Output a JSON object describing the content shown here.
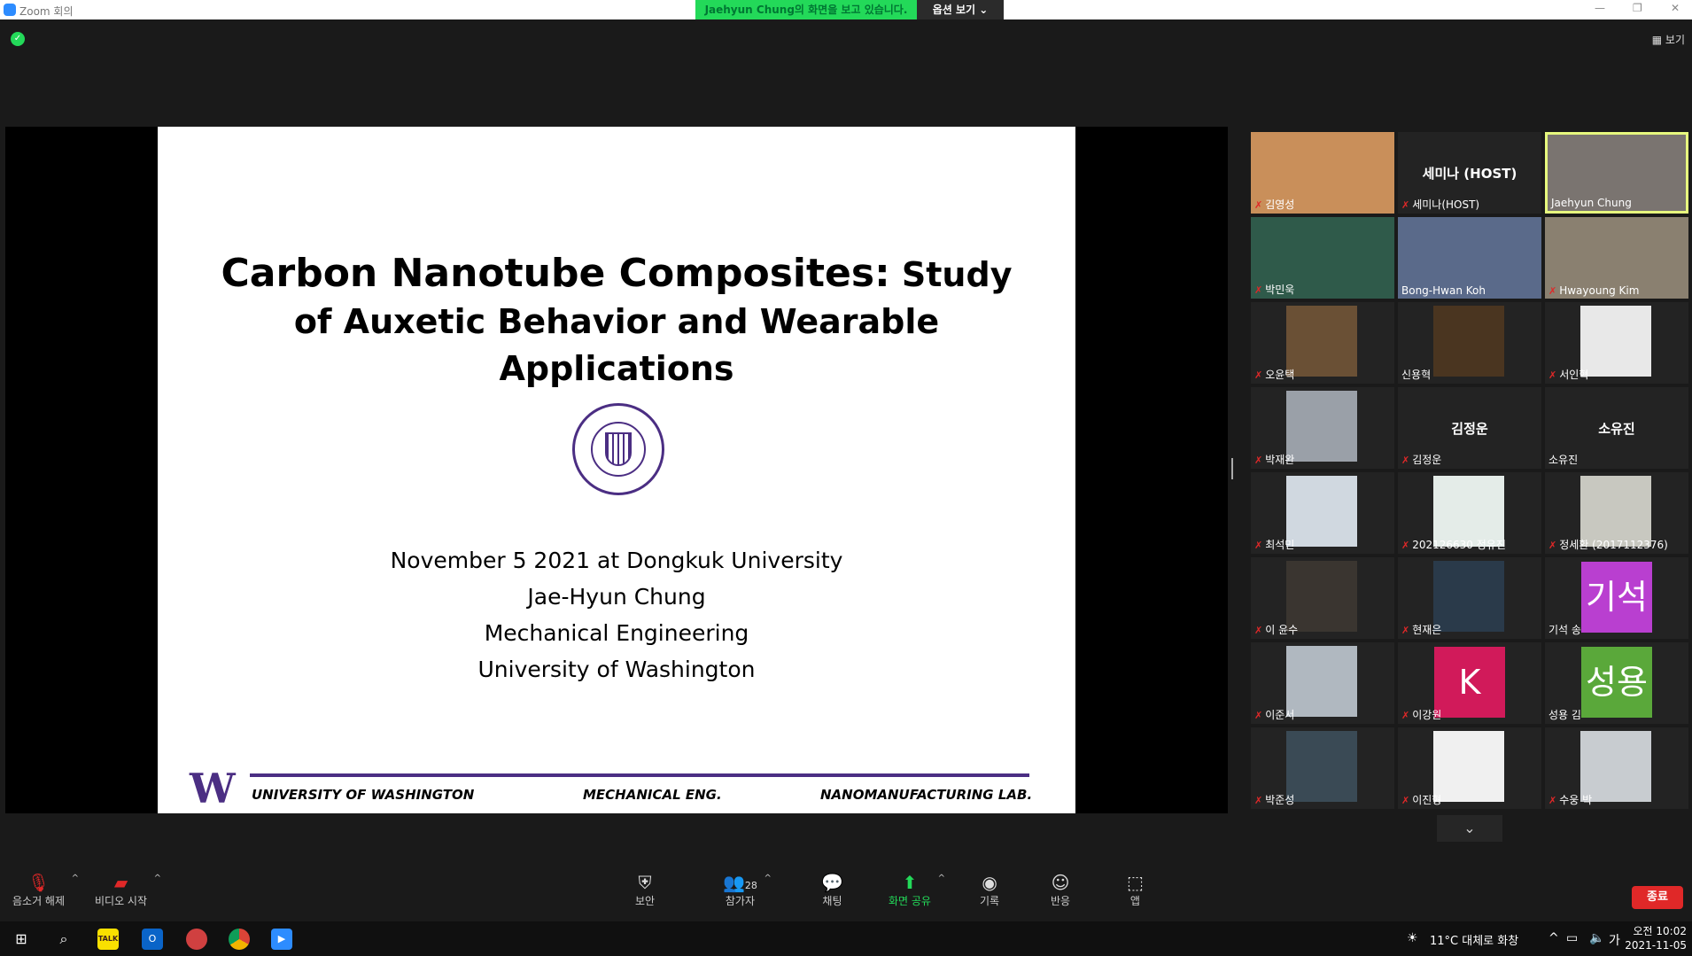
{
  "window": {
    "title": "Zoom 회의",
    "viewing_banner": "Jaehyun Chung의 화면을 보고 있습니다.",
    "view_options": "옵션 보기 ⌄",
    "view_button": "보기"
  },
  "slide": {
    "title_line1a": "Carbon Nanotube Composites:",
    "title_line1b": " Study",
    "title_line2": "of Auxetic Behavior and Wearable",
    "title_line3": "Applications",
    "line1": "November 5 2021 at Dongkuk University",
    "line2": "Jae-Hyun Chung",
    "line3": "Mechanical Engineering",
    "line4": "University of Washington",
    "footer_left": "UNIVERSITY OF WASHINGTON",
    "footer_mid": "MECHANICAL ENG.",
    "footer_right": "NANOMANUFACTURING LAB.",
    "logo_letter": "W"
  },
  "participants": [
    {
      "name": "김영성",
      "muted": true,
      "kind": "video",
      "color": "#c98f5a"
    },
    {
      "name": "세미나(HOST)",
      "muted": true,
      "kind": "name",
      "center": "세미나 (HOST)"
    },
    {
      "name": "Jaehyun Chung",
      "muted": false,
      "kind": "video",
      "color": "#7a7470",
      "active": true
    },
    {
      "name": "박민욱",
      "muted": true,
      "kind": "video",
      "color": "#2f5a4a"
    },
    {
      "name": "Bong-Hwan Koh",
      "muted": false,
      "kind": "video",
      "color": "#5a6a8a"
    },
    {
      "name": "Hwayoung Kim",
      "muted": true,
      "kind": "video",
      "color": "#8a8070"
    },
    {
      "name": "오윤택",
      "muted": true,
      "kind": "video",
      "color": "#6a5035"
    },
    {
      "name": "신용혁",
      "muted": false,
      "kind": "video",
      "color": "#4a3520"
    },
    {
      "name": "서인혁",
      "muted": true,
      "kind": "video",
      "color": "#e8e8e8"
    },
    {
      "name": "박재완",
      "muted": true,
      "kind": "video",
      "color": "#9aa0a8"
    },
    {
      "name": "김정운",
      "muted": true,
      "kind": "name",
      "center": "김정운"
    },
    {
      "name": "소유진",
      "muted": false,
      "kind": "name",
      "center": "소유진"
    },
    {
      "name": "최석민",
      "muted": true,
      "kind": "video",
      "color": "#d0d8e0"
    },
    {
      "name": "202126630 정유진",
      "muted": true,
      "kind": "video",
      "color": "#e4ece8"
    },
    {
      "name": "정세환 (2017112376)",
      "muted": true,
      "kind": "video",
      "color": "#c8c8c0"
    },
    {
      "name": "이 윤수",
      "muted": true,
      "kind": "video",
      "color": "#3a3530"
    },
    {
      "name": "현재은",
      "muted": true,
      "kind": "video",
      "color": "#2a3a4a"
    },
    {
      "name": "기석 송",
      "muted": false,
      "kind": "avatar",
      "color": "#b93fd0",
      "center": "기석"
    },
    {
      "name": "이준서",
      "muted": true,
      "kind": "video",
      "color": "#b0b8c0"
    },
    {
      "name": "이강원",
      "muted": true,
      "kind": "avatar",
      "color": "#d11a5a",
      "center": "K"
    },
    {
      "name": "성용 김",
      "muted": false,
      "kind": "avatar",
      "color": "#5aa83a",
      "center": "성용"
    },
    {
      "name": "박준성",
      "muted": true,
      "kind": "video",
      "color": "#3a4a55"
    },
    {
      "name": "이진형",
      "muted": true,
      "kind": "video",
      "color": "#f0f0f0"
    },
    {
      "name": "수웅 박",
      "muted": true,
      "kind": "video",
      "color": "#c8ccd0"
    }
  ],
  "toolbar": {
    "unmute": "음소거 해제",
    "start_video": "비디오 시작",
    "security": "보안",
    "participants": "참가자",
    "participant_count": "28",
    "chat": "채팅",
    "share": "화면 공유",
    "record": "기록",
    "reactions": "반응",
    "apps": "앱",
    "end": "종료"
  },
  "taskbar": {
    "weather": "11°C 대체로 화창",
    "ime": "가",
    "time": "오전 10:02",
    "date": "2021-11-05",
    "kakao": "TALK"
  }
}
